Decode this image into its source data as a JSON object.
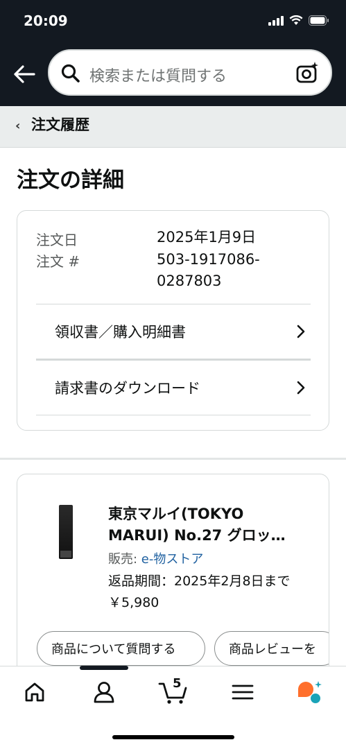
{
  "status_bar": {
    "time": "20:09"
  },
  "header": {
    "search_placeholder": "検索または質問する"
  },
  "breadcrumb": {
    "label": "注文履歴"
  },
  "page_title": "注文の詳細",
  "order": {
    "date_label": "注文日",
    "date_value": "2025年1月9日",
    "number_label": "注文 #",
    "number_value_line1": "503-1917086-",
    "number_value_line2": "0287803",
    "links": [
      {
        "label": "領収書／購入明細書"
      },
      {
        "label": "請求書のダウンロード"
      }
    ]
  },
  "item": {
    "title_line1": "東京マルイ(TOKYO",
    "title_line2": "MARUI) No.27 グロッ…",
    "seller_prefix": "販売: ",
    "seller_name": "e-物ストア",
    "return_period": "返品期間：2025年2月8日まで",
    "price": "￥5,980",
    "buttons": [
      {
        "label": "商品について質問する"
      },
      {
        "label": "商品レビューを"
      }
    ]
  },
  "bottom_nav": {
    "cart_count": "5",
    "items": [
      {
        "icon": "home-icon"
      },
      {
        "icon": "account-icon"
      },
      {
        "icon": "cart-icon"
      },
      {
        "icon": "menu-icon"
      },
      {
        "icon": "rufus-icon"
      }
    ]
  },
  "colors": {
    "header_bg": "#131921",
    "link": "#2162a1",
    "rufus_orange": "#ff6f2c",
    "rufus_teal": "#1aa3b8"
  }
}
